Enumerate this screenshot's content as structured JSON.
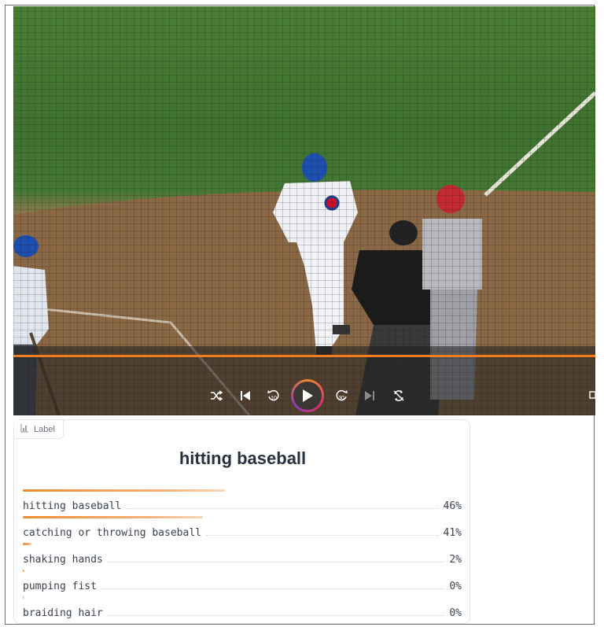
{
  "video": {
    "progress_fraction": 1.0,
    "controls": [
      {
        "name": "shuffle-icon"
      },
      {
        "name": "skip-back-icon"
      },
      {
        "name": "rewind-10-icon",
        "text": "10"
      },
      {
        "name": "play-icon"
      },
      {
        "name": "forward-30-icon",
        "text": "30"
      },
      {
        "name": "skip-forward-icon"
      },
      {
        "name": "loop-off-icon"
      }
    ],
    "accent_colors": {
      "progress": "#f27c22",
      "ring_start": "#f28a2e",
      "ring_mid": "#d6356e",
      "ring_end": "#8f3bb0"
    }
  },
  "label_panel": {
    "badge_icon": "bar-chart-icon",
    "badge_label": "Label",
    "top_label": "hitting baseball",
    "confidences": [
      {
        "label": "hitting baseball",
        "percent_text": "46%",
        "value": 0.46
      },
      {
        "label": "catching or throwing baseball",
        "percent_text": "41%",
        "value": 0.41
      },
      {
        "label": "shaking hands",
        "percent_text": "2%",
        "value": 0.02
      },
      {
        "label": "pumping fist",
        "percent_text": "0%",
        "value": 0.004
      },
      {
        "label": "braiding hair",
        "percent_text": "0%",
        "value": 0.001
      }
    ]
  }
}
